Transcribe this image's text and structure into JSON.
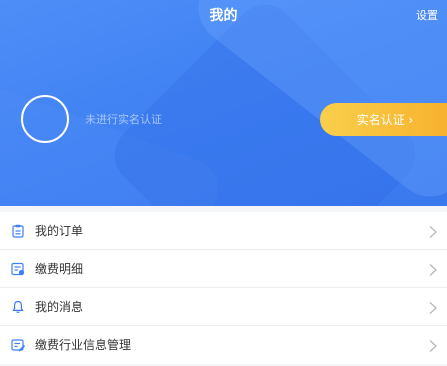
{
  "header": {
    "title": "我的",
    "settings_label": "设置",
    "verify_status": "未进行实名认证",
    "verify_button_label": "实名认证 ›"
  },
  "menu": {
    "items": [
      {
        "label": "我的订单",
        "icon": "order-clipboard-icon"
      },
      {
        "label": "缴费明细",
        "icon": "payment-detail-icon"
      },
      {
        "label": "我的消息",
        "icon": "bell-icon"
      },
      {
        "label": "缴费行业信息管理",
        "icon": "industry-info-card-icon"
      }
    ]
  },
  "colors": {
    "header_blue": "#3e7ff2",
    "accent_yellow": "#f7b12d",
    "icon_blue": "#3e7ff2"
  }
}
